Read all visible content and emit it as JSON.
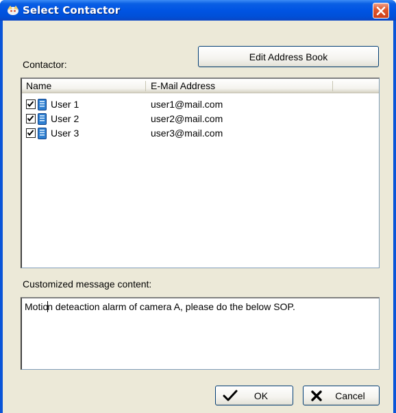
{
  "window": {
    "title": "Select Contactor"
  },
  "contactor": {
    "label": "Contactor:",
    "edit_button": "Edit Address Book",
    "columns": [
      "Name",
      "E-Mail Address"
    ],
    "rows": [
      {
        "name": "User 1",
        "email": "user1@mail.com",
        "checked": true
      },
      {
        "name": "User 2",
        "email": "user2@mail.com",
        "checked": true
      },
      {
        "name": "User 3",
        "email": "user3@mail.com",
        "checked": true
      }
    ]
  },
  "message": {
    "label": "Customized message content:",
    "before_caret": "Motio",
    "after_caret": "n deteaction alarm of camera A, please do the below SOP."
  },
  "buttons": {
    "ok": "OK",
    "cancel": "Cancel"
  },
  "colors": {
    "titlebar": "#0054e3",
    "client_bg": "#ece9d8",
    "close_button": "#e0582e"
  }
}
